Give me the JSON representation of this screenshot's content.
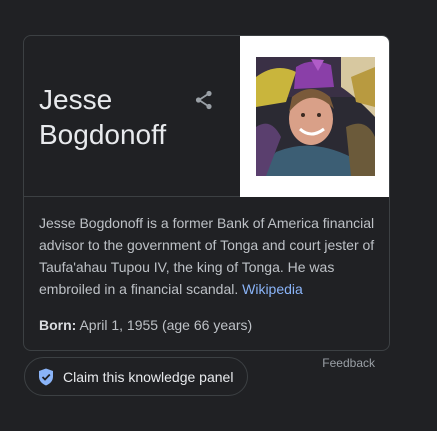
{
  "panel": {
    "title_line1": "Jesse",
    "title_line2": "Bogdonoff",
    "description": "Jesse Bogdonoff is a former Bank of America financial advisor to the government of Tonga and court jester of Taufa'ahau Tupou IV, the king of Tonga. He was embroiled in a financial scandal.",
    "source_link": "Wikipedia",
    "born_label": "Born:",
    "born_value": "April 1, 1955 (age 66 years)"
  },
  "actions": {
    "claim_label": "Claim this knowledge panel",
    "feedback_label": "Feedback"
  },
  "icons": {
    "share": "share-icon",
    "claim": "shield-check-icon"
  },
  "colors": {
    "background": "#202124",
    "link": "#8ab4f8",
    "shield": "#8ab4f8"
  }
}
